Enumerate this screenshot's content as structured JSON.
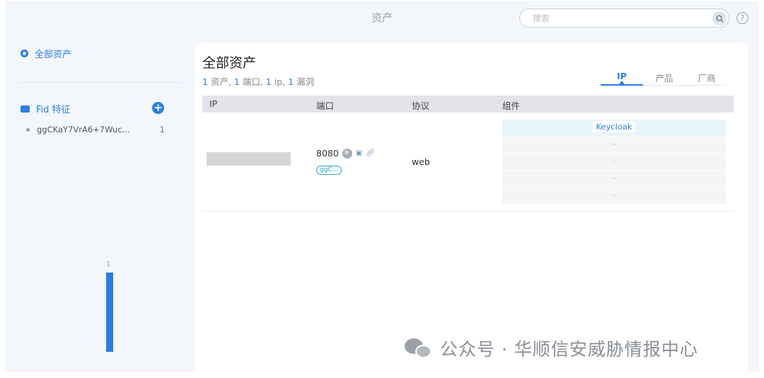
{
  "header": {
    "title": "资产",
    "search_placeholder": "搜索",
    "help_label": "?"
  },
  "sidebar": {
    "all_assets_label": "全部资产",
    "fid_section_label": "Fid 特征",
    "fid_items": [
      {
        "name": "ggCKaY7VrA6+7Wuc...",
        "count": "1"
      }
    ],
    "chart_bar_label": "1",
    "chart_bar_value": 1
  },
  "main": {
    "title": "全部资产",
    "summary": {
      "assets_count": "1",
      "assets_label": "资产, ",
      "ports_count": "1",
      "ports_label": "端口, ",
      "ip_count": "1",
      "ip_label": "ip, ",
      "vuln_count": "1",
      "vuln_label": "漏洞"
    },
    "tabs": [
      {
        "label": "IP",
        "active": true
      },
      {
        "label": "产品",
        "active": false
      },
      {
        "label": "厂商",
        "active": false
      }
    ],
    "table": {
      "columns": [
        "IP",
        "端口",
        "协议",
        "组件"
      ],
      "rows": [
        {
          "ip": "",
          "port": "8080",
          "port_tag": "ggC...",
          "protocol": "web",
          "components": [
            "Keycloak",
            "-",
            "-",
            "-",
            "-"
          ]
        }
      ]
    }
  },
  "watermark": {
    "text": "公众号 · 华顺信安威胁情报中心"
  },
  "colors": {
    "accent": "#2b7fe1",
    "background": "#f3f6fb"
  }
}
